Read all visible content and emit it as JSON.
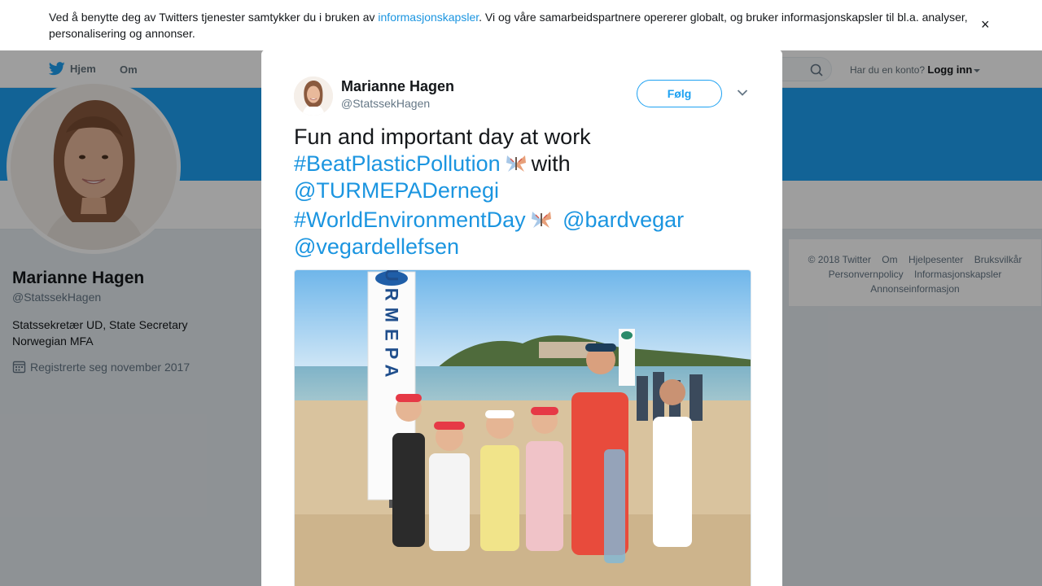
{
  "cookie": {
    "text_before": "Ved å benytte deg av Twitters tjenester samtykker du i bruken av ",
    "link": "informasjonskapsler",
    "text_after": ". Vi og våre samarbeidspartnere opererer globalt, og bruker informasjonskapsler til bl.a. analyser, personalisering og annonser.",
    "close": "×"
  },
  "modal_close": "✕",
  "nav": {
    "home": "Hjem",
    "about": "Om",
    "account_prompt": "Har du en konto?",
    "login": "Logg inn"
  },
  "profile": {
    "name": "Marianne Hagen",
    "handle": "@StatssekHagen",
    "bio_line1": "Statssekretær UD, State Secretary",
    "bio_line2": "Norwegian MFA",
    "joined": "Registrerte seg november 2017"
  },
  "footer": {
    "line1": [
      "© 2018 Twitter",
      "Om",
      "Hjelpesenter",
      "Bruksvilkår"
    ],
    "line2": [
      "Personvernpolicy",
      "Informasjonskapsler"
    ],
    "line3": [
      "Annonseinformasjon"
    ]
  },
  "tweet": {
    "author_name": "Marianne Hagen",
    "author_handle": "@StatssekHagen",
    "follow_label": "Følg",
    "text_plain1": "Fun and important day at work",
    "hashtag1": "#BeatPlasticPollution",
    "text_plain2": "with",
    "mention1": "@TURMEPADernegi",
    "hashtag2": "#WorldEnvironmentDay",
    "mention2": "@bardvegar",
    "mention3": "@vegardellefsen",
    "banner_text": "TURMEPA"
  },
  "colors": {
    "twitter_blue": "#1da1f2",
    "link_blue": "#1b95e0"
  },
  "icons": [
    "twitter-bird-icon",
    "search-icon",
    "calendar-icon",
    "close-icon",
    "chevron-down-icon",
    "butterfly-emoji-icon"
  ]
}
